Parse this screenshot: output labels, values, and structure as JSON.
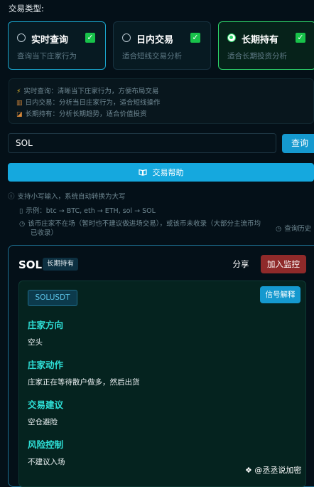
{
  "section_label": "交易类型:",
  "modes": [
    {
      "title": "实时查询",
      "desc": "查询当下庄家行为",
      "selected": false
    },
    {
      "title": "日内交易",
      "desc": "适合短线交易分析",
      "selected": false
    },
    {
      "title": "长期持有",
      "desc": "适合长期投资分析",
      "selected": true
    }
  ],
  "info": {
    "line1": "实时查询：清晰当下庄家行为，方便布局交易",
    "line2": "日内交易：分析当日庄家行为，适合短线操作",
    "line3": "长期持有：分析长期趋势，适合价值投资"
  },
  "search": {
    "value": "SOL"
  },
  "buttons": {
    "query": "查询",
    "help": "交易帮助"
  },
  "hints": {
    "h1": "支持小写输入，系统自动转换为大写",
    "h2": "示例：btc → BTC, eth → ETH, sol → SOL",
    "h3a": "该币庄家不在场（暂时也不建议做进场交易），或该币未收录（大部分主流币均",
    "h3b": "已收录）",
    "history": "查询历史"
  },
  "result": {
    "coin": "SOL",
    "term_tag": "长期持有",
    "share": "分享",
    "monitor": "加入监控",
    "pair": "SOLUSDT",
    "signal_btn": "信号解释",
    "sections": [
      {
        "title": "庄家方向",
        "value": "空头"
      },
      {
        "title": "庄家动作",
        "value": "庄家正在等待散户做多，然后出货"
      },
      {
        "title": "交易建议",
        "value": "空仓避险"
      },
      {
        "title": "风险控制",
        "value": "不建议入场"
      }
    ]
  },
  "watermark": "❖ @丞丞说加密",
  "colors": {
    "accent_blue": "#1599cf",
    "accent_teal": "#2ee0d7",
    "monitor_red": "#8f2a2a",
    "check_green": "#18c24a"
  }
}
